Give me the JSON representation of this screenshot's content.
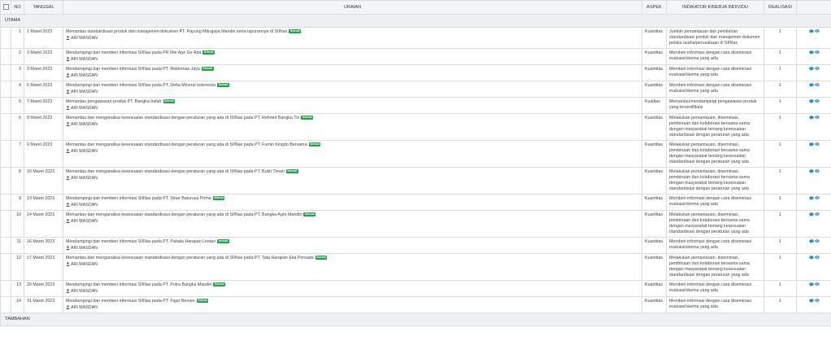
{
  "header": {
    "no": "NO",
    "tanggal": "TANGGAL",
    "uraian": "URAIAN",
    "aspek": "ASPEK",
    "indikator": "INDIKATOR KINERJA INDIVIDU",
    "realisasi": "REALISASI"
  },
  "sections": {
    "utama": "UTAMA",
    "tambahan": "TAMBAHAN"
  },
  "badge_label": "Selesai",
  "user_name": "ARI MASDAN",
  "colors": {
    "badge": "#22a34a",
    "icon": "#2a8bd8",
    "header_bg": "#f4f5f7"
  },
  "icons": {
    "user": "user-icon",
    "comment": "comment-icon",
    "view": "eye-icon"
  },
  "rows": [
    {
      "no": "1",
      "tanggal": "1 Maret 2023",
      "uraian": "Memantau standardisasi produk dan manajemen dokumen PT. Payung Mitrajaya Mandiri serta laporannya di SIINas",
      "aspek": "Kuantitas",
      "indikator": "Jumlah pemantauan dan pemilahan standardisasi produk dan manajemen dokumen pelaku usaha/perusahaan di SIINas",
      "realisasi": "1"
    },
    {
      "no": "2",
      "tanggal": "2 Maret 2023",
      "uraian": "Mendampingi dan memberi informasi SIINas pada PR Mie Ape Ge Ada",
      "aspek": "Kuantitas",
      "indikator": "Memberi informasi dengan cara diseminasi evaluasi/skema yang ada",
      "realisasi": "1"
    },
    {
      "no": "3",
      "tanggal": "3 Maret 2023",
      "uraian": "Mendampingi dan memberi informasi SIINas pada PT. Rebinmas Jaya",
      "aspek": "Kuantitas",
      "indikator": "Memberi informasi dengan cara diseminasi evaluasi/skema yang ada",
      "realisasi": "1"
    },
    {
      "no": "4",
      "tanggal": "6 Maret 2023",
      "uraian": "Mendampingi dan memberi informasi SIINas pada PT. Delta Mineral Indonesia",
      "aspek": "Kuantitas",
      "indikator": "Memberi informasi dengan cara diseminasi evaluasi/skema yang ada",
      "realisasi": "1"
    },
    {
      "no": "5",
      "tanggal": "7 Maret 2023",
      "uraian": "Memantau pengawasan produk PT. Bangka Indah",
      "aspek": "Kualitas",
      "indikator": "Memantau/mendampingi pengawasan produk yang tersertifikasi",
      "realisasi": "1"
    },
    {
      "no": "6",
      "tanggal": "8 Maret 2023",
      "uraian": "Memantau dan menganalisa kesesuaian standardisasi dengan peraturan yang ada di SIINas pada PT. Refined Bangka Tin",
      "aspek": "Kuantitas",
      "indikator": "Melakukan pemantauan, diseminasi, pembinaan dan kolaborasi bersama-sama dengan masyarakat tentang kesesuaian standardisasi dengan peraturan yang ada",
      "realisasi": "1"
    },
    {
      "no": "7",
      "tanggal": "9 Maret 2023",
      "uraian": "Memantau dan menganalisa kesesuaian standardisasi dengan peraturan yang ada di SIINas pada PT. Fumin Kingdo Bersama",
      "aspek": "Kuantitas",
      "indikator": "Melakukan pemantauan, diseminasi, pembinaan dan kolaborasi bersama-sama dengan masyarakat tentang kesesuaian standardisasi dengan peraturan yang ada",
      "realisasi": "1"
    },
    {
      "no": "8",
      "tanggal": "10 Maret 2023",
      "uraian": "Memantau dan menganalisa kesesuaian standardisasi dengan peraturan yang ada di SIINas pada PT. Bukit Timah",
      "aspek": "Kuantitas",
      "indikator": "Melakukan pemantauan, diseminasi, pembinaan dan kolaborasi bersama-sama dengan masyarakat tentang kesesuaian standardisasi dengan peraturan yang ada",
      "realisasi": "1"
    },
    {
      "no": "9",
      "tanggal": "13 Maret 2023",
      "uraian": "Mendampingi dan memberi informasi SIINas pada PT. Sinar Baturusa Prima",
      "aspek": "Kuantitas",
      "indikator": "Memberi informasi dengan cara diseminasi evaluasi/skema yang ada",
      "realisasi": "1"
    },
    {
      "no": "10",
      "tanggal": "14 Maret 2023",
      "uraian": "Memantau dan menganalisa kesesuaian standardisasi dengan peraturan yang ada di SIINas pada PT. Bangka Agro Mandiri",
      "aspek": "Kuantitas",
      "indikator": "Melakukan pemantauan, diseminasi, pembinaan dan kolaborasi bersama-sama dengan masyarakat tentang kesesuaian standardisasi dengan peraturan yang ada",
      "realisasi": "1"
    },
    {
      "no": "11",
      "tanggal": "16 Maret 2023",
      "uraian": "Mendampingi dan memberi informasi SIINas pada PT. Pahala Harapan Lestari",
      "aspek": "Kuantitas",
      "indikator": "Memberi informasi dengan cara diseminasi evaluasi/skema yang ada",
      "realisasi": "1"
    },
    {
      "no": "12",
      "tanggal": "17 Maret 2023",
      "uraian": "Memantau dan menganalisa kesesuaian standardisasi dengan peraturan yang ada di SIINas pada PT. Tata Harapan Eka Persada",
      "aspek": "Kuantitas",
      "indikator": "Melakukan pemantauan, diseminasi, pembinaan dan kolaborasi bersama-sama dengan masyarakat tentang kesesuaian standardisasi dengan peraturan yang ada",
      "realisasi": "1"
    },
    {
      "no": "13",
      "tanggal": "20 Maret 2023",
      "uraian": "Mendampingi dan memberi informasi SIINas pada PT. Putra Bangka Mandiri",
      "aspek": "Kuantitas",
      "indikator": "Memberi informasi dengan cara diseminasi evaluasi/skema yang ada",
      "realisasi": "1"
    },
    {
      "no": "14",
      "tanggal": "31 Maret 2023",
      "uraian": "Mendampingi dan memberi informasi SIINas pada PT. Fajar Bersen",
      "aspek": "Kuantitas",
      "indikator": "Memberi informasi dengan cara diseminasi evaluasi/skema yang ada",
      "realisasi": "1"
    }
  ]
}
